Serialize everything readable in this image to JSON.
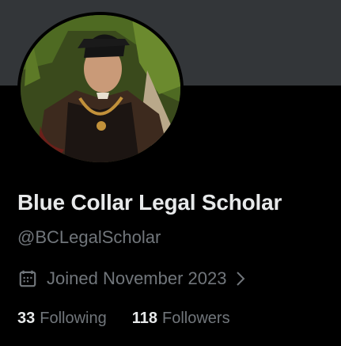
{
  "profile": {
    "display_name": "Blue Collar Legal Scholar",
    "handle": "@BCLegalScholar",
    "joined_text": "Joined November 2023",
    "following_count": "33",
    "following_label": "Following",
    "followers_count": "118",
    "followers_label": "Followers"
  },
  "icons": {
    "joined": "calendar-icon",
    "joined_arrow": "chevron-right-icon"
  },
  "colors": {
    "background": "#000000",
    "banner": "#333639",
    "primary_text": "#e7e9ea",
    "secondary_text": "#71767b"
  }
}
